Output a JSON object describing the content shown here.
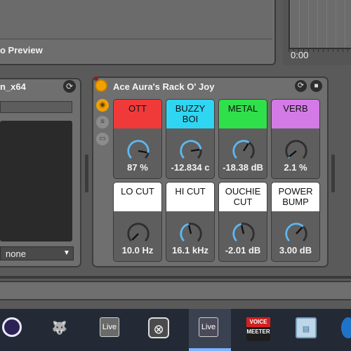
{
  "top": {
    "preview_label": "o Preview",
    "time_label": "0:00"
  },
  "left_device": {
    "title": "n_x64",
    "select_value": "none",
    "hotswap_icon": "hotswap-icon"
  },
  "rack": {
    "title": "Ace Aura's Rack O' Joy",
    "macros": [
      {
        "label": "OTT",
        "value": "87 %",
        "color": "#f03a3a",
        "level": 0.87
      },
      {
        "label": "BUZZY BOI",
        "value": "-12.834 c",
        "color": "#2fd6f2",
        "level": 0.8
      },
      {
        "label": "METAL",
        "value": "-18.38 dB",
        "color": "#2fe04a",
        "level": 0.62
      },
      {
        "label": "VERB",
        "value": "2.1 %",
        "color": "#d47ae6",
        "level": 0.02
      },
      {
        "label": "LO CUT",
        "value": "10.0 Hz",
        "color": "#ffffff",
        "level": 0.0
      },
      {
        "label": "HI CUT",
        "value": "16.1 kHz",
        "color": "#ffffff",
        "level": 0.45
      },
      {
        "label": "OUCHIE CUT",
        "value": "-2.01 dB",
        "color": "#ffffff",
        "level": 0.45
      },
      {
        "label": "POWER BUMP",
        "value": "3.00 dB",
        "color": "#ffffff",
        "level": 0.66
      }
    ],
    "accent_color": "#5fb8f0"
  },
  "taskbar": {
    "items": [
      {
        "name": "eclipse-icon",
        "label": ""
      },
      {
        "name": "gimp-icon",
        "label": ""
      },
      {
        "name": "ableton-live-icon",
        "label": "Live"
      },
      {
        "name": "steam-like-icon",
        "label": ""
      },
      {
        "name": "ableton-live-active-icon",
        "label": "Live"
      },
      {
        "name": "voicemeeter-icon",
        "label_top": "VOICE",
        "label_bottom": "MEETER"
      },
      {
        "name": "network-monitor-icon",
        "label": ""
      },
      {
        "name": "browser-icon",
        "label": ""
      }
    ]
  }
}
